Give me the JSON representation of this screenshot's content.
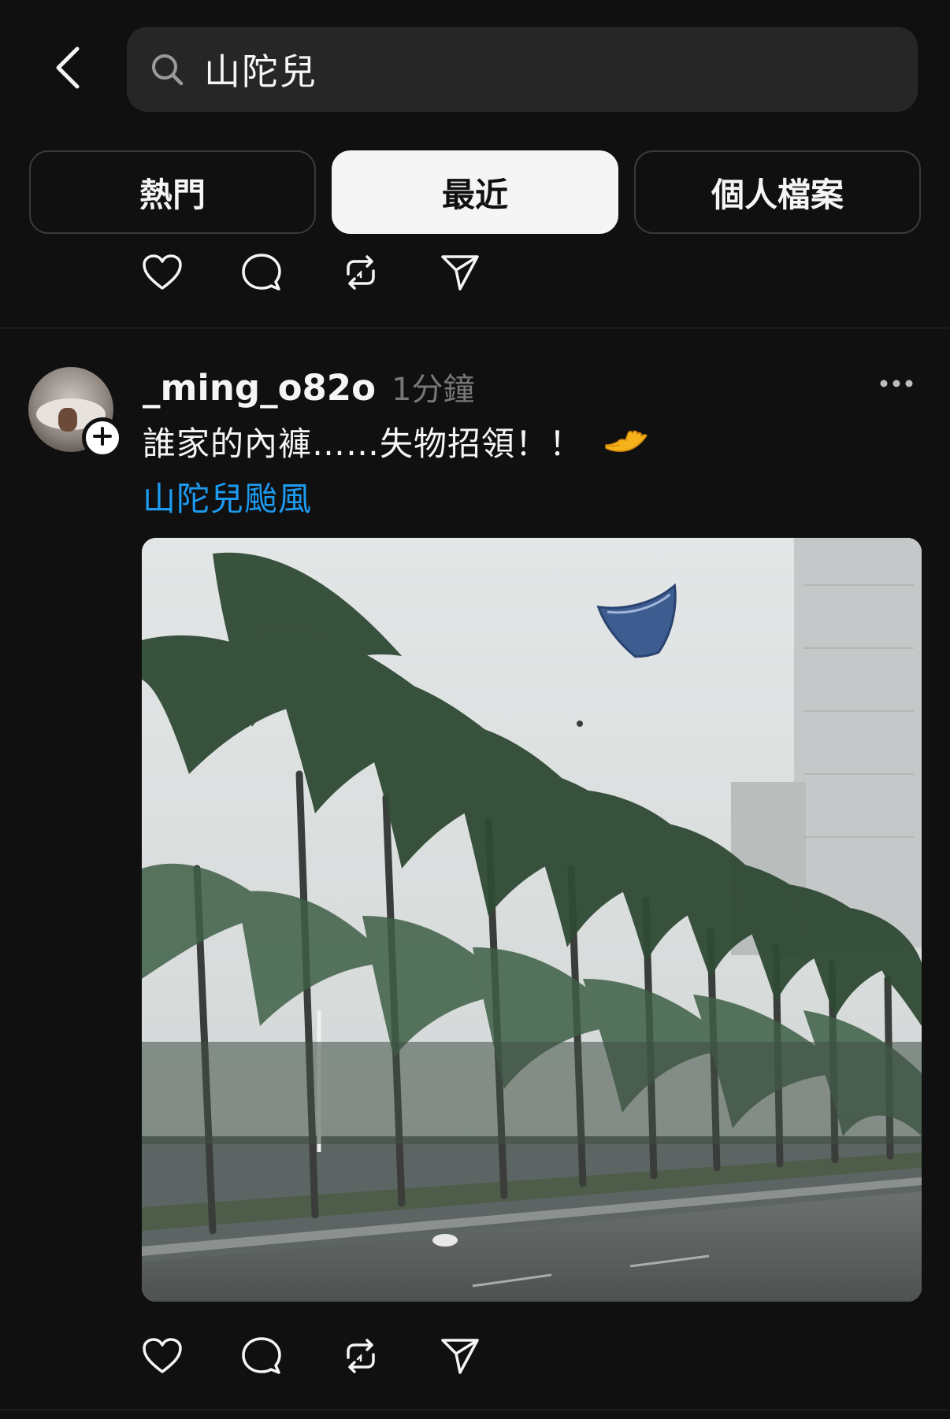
{
  "header": {
    "back_icon": "chevron-left-icon",
    "search_icon": "search-icon",
    "search_value": "山陀兒"
  },
  "tabs": [
    {
      "label": "熱門",
      "active": false
    },
    {
      "label": "最近",
      "active": true
    },
    {
      "label": "個人檔案",
      "active": false
    }
  ],
  "prev_post_actions": [
    "heart-icon",
    "comment-icon",
    "repost-icon",
    "share-icon"
  ],
  "post": {
    "username": "_ming_o82o",
    "timestamp": "1分鐘",
    "caption": "誰家的內褲……失物招領！！",
    "caption_emoji": "open-palm-up-emoji",
    "hashtag": "山陀兒颱風",
    "media_description_icon": "photo",
    "actions": [
      "heart-icon",
      "comment-icon",
      "repost-icon",
      "share-icon"
    ],
    "more_icon": "more-horizontal-icon",
    "follow_icon": "plus-icon"
  },
  "colors": {
    "background": "#101010",
    "text": "#f3f5f7",
    "muted": "#777777",
    "link": "#1d9bf0",
    "active_tab_bg": "#f5f5f5"
  }
}
